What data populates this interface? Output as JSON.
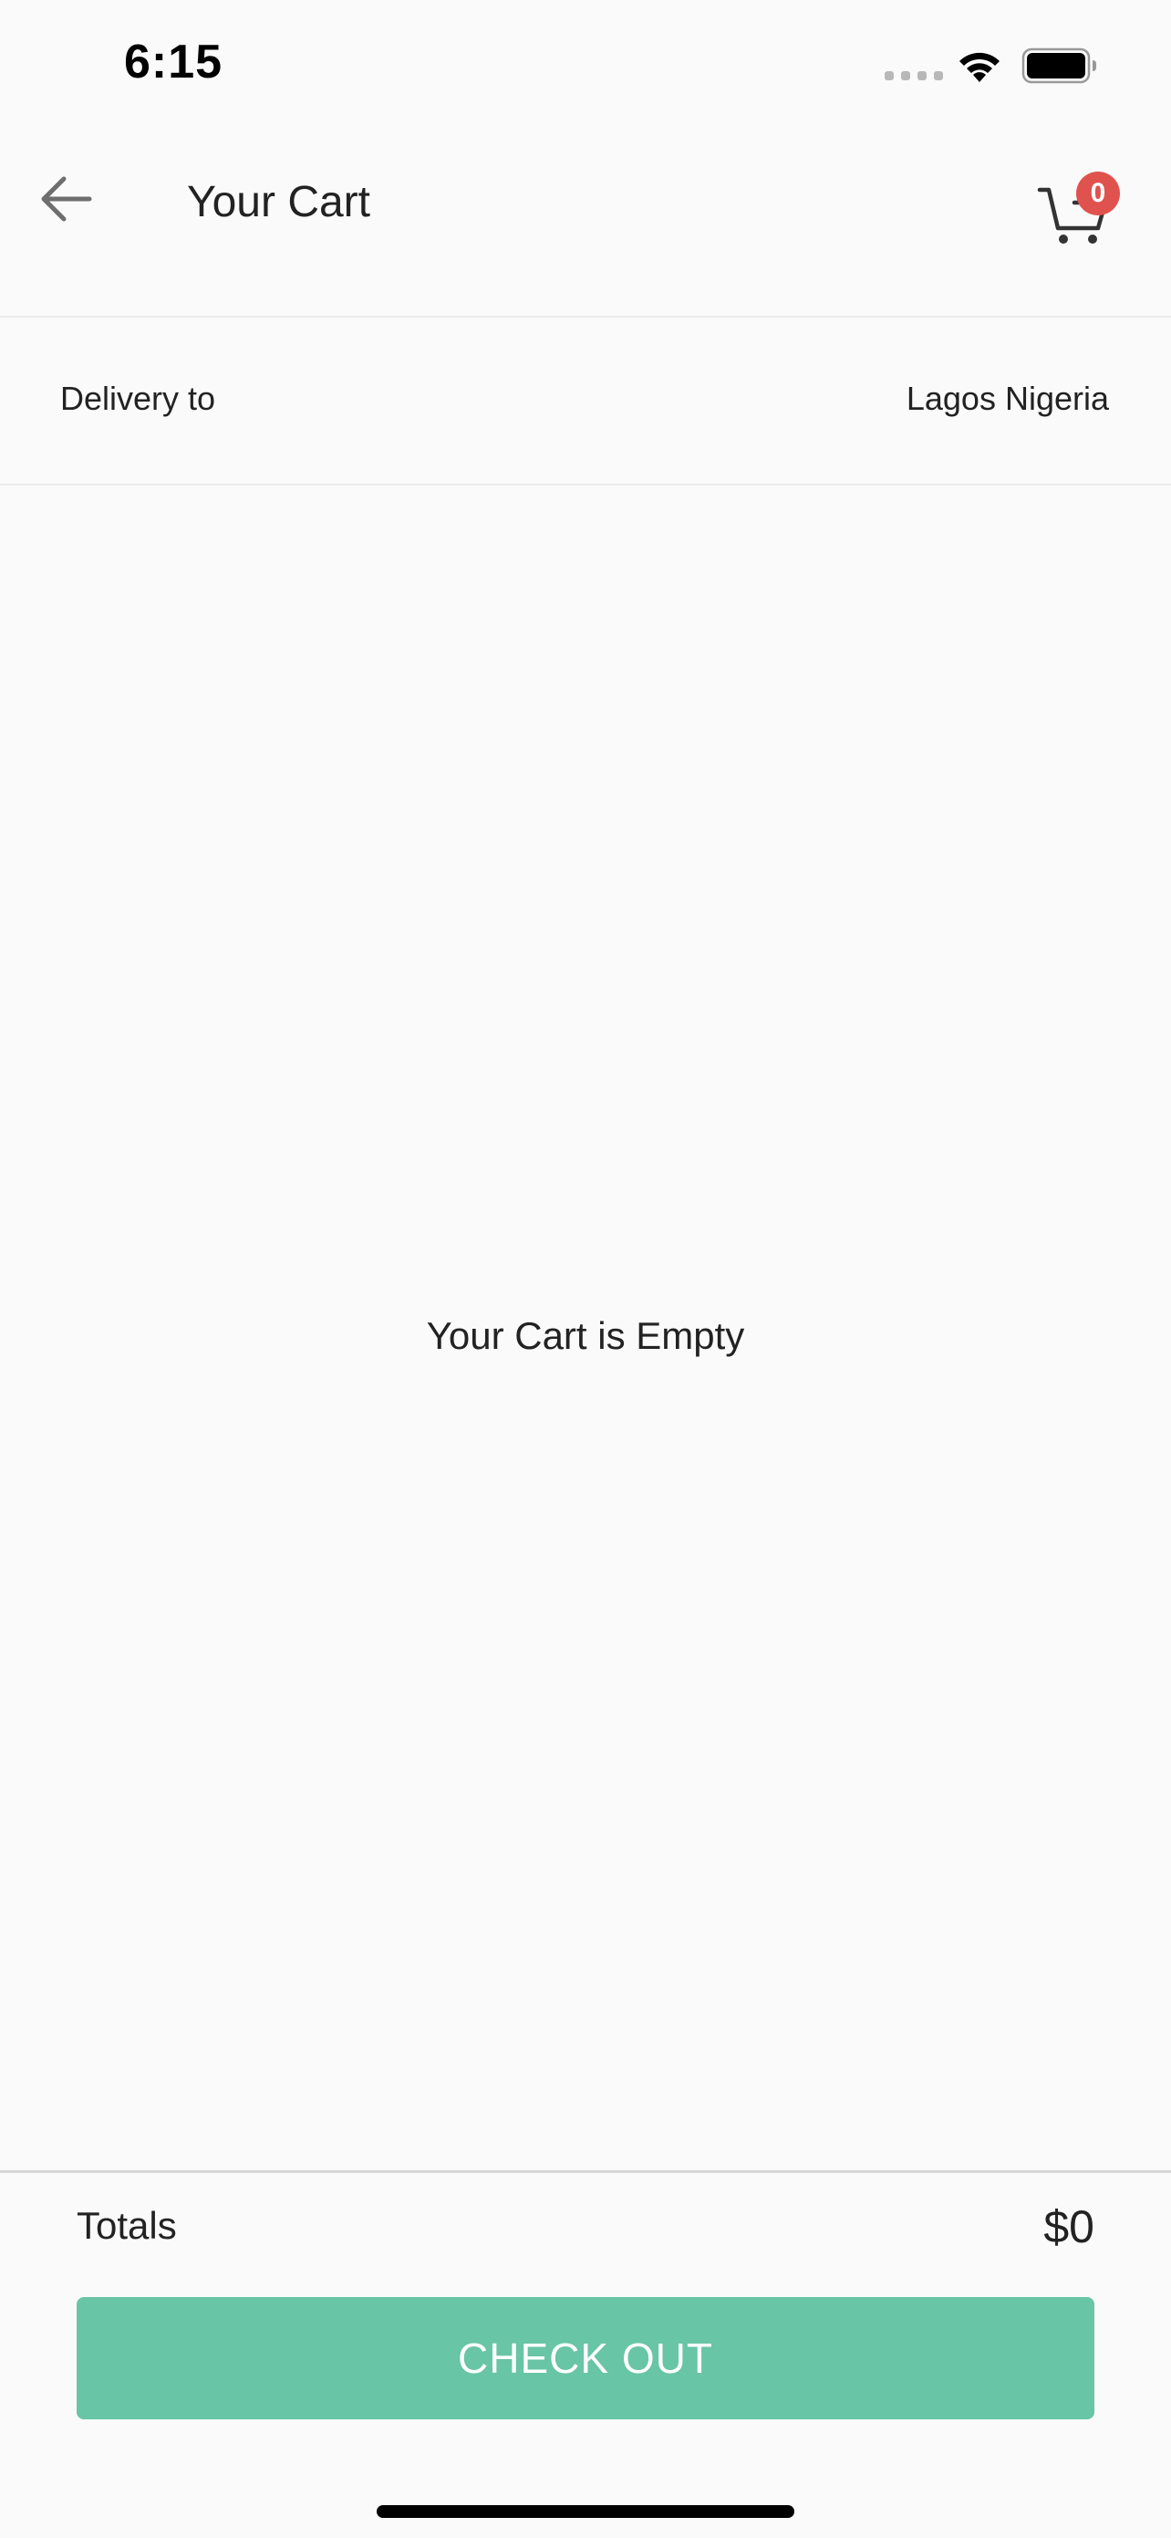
{
  "status_bar": {
    "time": "6:15",
    "wifi_icon": "wifi-icon",
    "battery_icon": "battery-icon"
  },
  "header": {
    "title": "Your Cart",
    "back_icon": "arrow-left-icon",
    "cart_icon": "shopping-cart-icon",
    "cart_count": "0"
  },
  "delivery": {
    "label": "Delivery to",
    "location": "Lagos Nigeria"
  },
  "cart": {
    "empty_message": "Your Cart is Empty"
  },
  "footer": {
    "totals_label": "Totals",
    "totals_value": "$0",
    "checkout_label": "CHECK OUT"
  },
  "colors": {
    "background": "#fafafa",
    "accent": "#68c5a6",
    "badge": "#e0524e",
    "text": "#222222"
  }
}
